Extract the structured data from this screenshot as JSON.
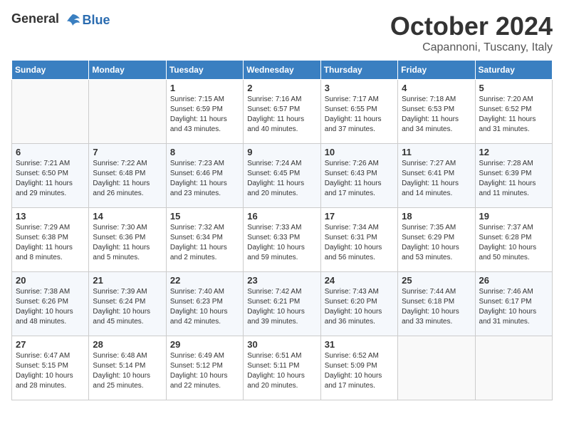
{
  "header": {
    "logo_general": "General",
    "logo_blue": "Blue",
    "title": "October 2024",
    "location": "Capannoni, Tuscany, Italy"
  },
  "weekdays": [
    "Sunday",
    "Monday",
    "Tuesday",
    "Wednesday",
    "Thursday",
    "Friday",
    "Saturday"
  ],
  "weeks": [
    [
      {
        "day": "",
        "info": ""
      },
      {
        "day": "",
        "info": ""
      },
      {
        "day": "1",
        "info": "Sunrise: 7:15 AM\nSunset: 6:59 PM\nDaylight: 11 hours and 43 minutes."
      },
      {
        "day": "2",
        "info": "Sunrise: 7:16 AM\nSunset: 6:57 PM\nDaylight: 11 hours and 40 minutes."
      },
      {
        "day": "3",
        "info": "Sunrise: 7:17 AM\nSunset: 6:55 PM\nDaylight: 11 hours and 37 minutes."
      },
      {
        "day": "4",
        "info": "Sunrise: 7:18 AM\nSunset: 6:53 PM\nDaylight: 11 hours and 34 minutes."
      },
      {
        "day": "5",
        "info": "Sunrise: 7:20 AM\nSunset: 6:52 PM\nDaylight: 11 hours and 31 minutes."
      }
    ],
    [
      {
        "day": "6",
        "info": "Sunrise: 7:21 AM\nSunset: 6:50 PM\nDaylight: 11 hours and 29 minutes."
      },
      {
        "day": "7",
        "info": "Sunrise: 7:22 AM\nSunset: 6:48 PM\nDaylight: 11 hours and 26 minutes."
      },
      {
        "day": "8",
        "info": "Sunrise: 7:23 AM\nSunset: 6:46 PM\nDaylight: 11 hours and 23 minutes."
      },
      {
        "day": "9",
        "info": "Sunrise: 7:24 AM\nSunset: 6:45 PM\nDaylight: 11 hours and 20 minutes."
      },
      {
        "day": "10",
        "info": "Sunrise: 7:26 AM\nSunset: 6:43 PM\nDaylight: 11 hours and 17 minutes."
      },
      {
        "day": "11",
        "info": "Sunrise: 7:27 AM\nSunset: 6:41 PM\nDaylight: 11 hours and 14 minutes."
      },
      {
        "day": "12",
        "info": "Sunrise: 7:28 AM\nSunset: 6:39 PM\nDaylight: 11 hours and 11 minutes."
      }
    ],
    [
      {
        "day": "13",
        "info": "Sunrise: 7:29 AM\nSunset: 6:38 PM\nDaylight: 11 hours and 8 minutes."
      },
      {
        "day": "14",
        "info": "Sunrise: 7:30 AM\nSunset: 6:36 PM\nDaylight: 11 hours and 5 minutes."
      },
      {
        "day": "15",
        "info": "Sunrise: 7:32 AM\nSunset: 6:34 PM\nDaylight: 11 hours and 2 minutes."
      },
      {
        "day": "16",
        "info": "Sunrise: 7:33 AM\nSunset: 6:33 PM\nDaylight: 10 hours and 59 minutes."
      },
      {
        "day": "17",
        "info": "Sunrise: 7:34 AM\nSunset: 6:31 PM\nDaylight: 10 hours and 56 minutes."
      },
      {
        "day": "18",
        "info": "Sunrise: 7:35 AM\nSunset: 6:29 PM\nDaylight: 10 hours and 53 minutes."
      },
      {
        "day": "19",
        "info": "Sunrise: 7:37 AM\nSunset: 6:28 PM\nDaylight: 10 hours and 50 minutes."
      }
    ],
    [
      {
        "day": "20",
        "info": "Sunrise: 7:38 AM\nSunset: 6:26 PM\nDaylight: 10 hours and 48 minutes."
      },
      {
        "day": "21",
        "info": "Sunrise: 7:39 AM\nSunset: 6:24 PM\nDaylight: 10 hours and 45 minutes."
      },
      {
        "day": "22",
        "info": "Sunrise: 7:40 AM\nSunset: 6:23 PM\nDaylight: 10 hours and 42 minutes."
      },
      {
        "day": "23",
        "info": "Sunrise: 7:42 AM\nSunset: 6:21 PM\nDaylight: 10 hours and 39 minutes."
      },
      {
        "day": "24",
        "info": "Sunrise: 7:43 AM\nSunset: 6:20 PM\nDaylight: 10 hours and 36 minutes."
      },
      {
        "day": "25",
        "info": "Sunrise: 7:44 AM\nSunset: 6:18 PM\nDaylight: 10 hours and 33 minutes."
      },
      {
        "day": "26",
        "info": "Sunrise: 7:46 AM\nSunset: 6:17 PM\nDaylight: 10 hours and 31 minutes."
      }
    ],
    [
      {
        "day": "27",
        "info": "Sunrise: 6:47 AM\nSunset: 5:15 PM\nDaylight: 10 hours and 28 minutes."
      },
      {
        "day": "28",
        "info": "Sunrise: 6:48 AM\nSunset: 5:14 PM\nDaylight: 10 hours and 25 minutes."
      },
      {
        "day": "29",
        "info": "Sunrise: 6:49 AM\nSunset: 5:12 PM\nDaylight: 10 hours and 22 minutes."
      },
      {
        "day": "30",
        "info": "Sunrise: 6:51 AM\nSunset: 5:11 PM\nDaylight: 10 hours and 20 minutes."
      },
      {
        "day": "31",
        "info": "Sunrise: 6:52 AM\nSunset: 5:09 PM\nDaylight: 10 hours and 17 minutes."
      },
      {
        "day": "",
        "info": ""
      },
      {
        "day": "",
        "info": ""
      }
    ]
  ]
}
